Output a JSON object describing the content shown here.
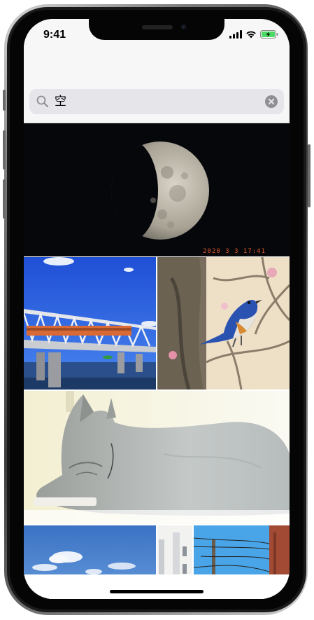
{
  "status_bar": {
    "time": "9:41",
    "icons": [
      "cellular-signal-icon",
      "wifi-icon",
      "battery-charging-icon"
    ],
    "battery_color": "#4cd964"
  },
  "search": {
    "query": "空",
    "icon": "magnifying-glass-icon",
    "clear_icon": "clear-circle-icon"
  },
  "results": {
    "photos": [
      {
        "subject": "moon",
        "date_stamp": "2020  3  3  17:41"
      },
      {
        "subject": "train-bridge"
      },
      {
        "subject": "blue-bird"
      },
      {
        "subject": "cat"
      },
      {
        "subject": "blue-sky-clouds"
      },
      {
        "subject": "building"
      },
      {
        "subject": "power-lines-sky"
      }
    ]
  },
  "colors": {
    "search_field_bg": "#e5e5ea",
    "bar_bg": "#f7f7f7",
    "date_stamp": "#e0582a"
  }
}
